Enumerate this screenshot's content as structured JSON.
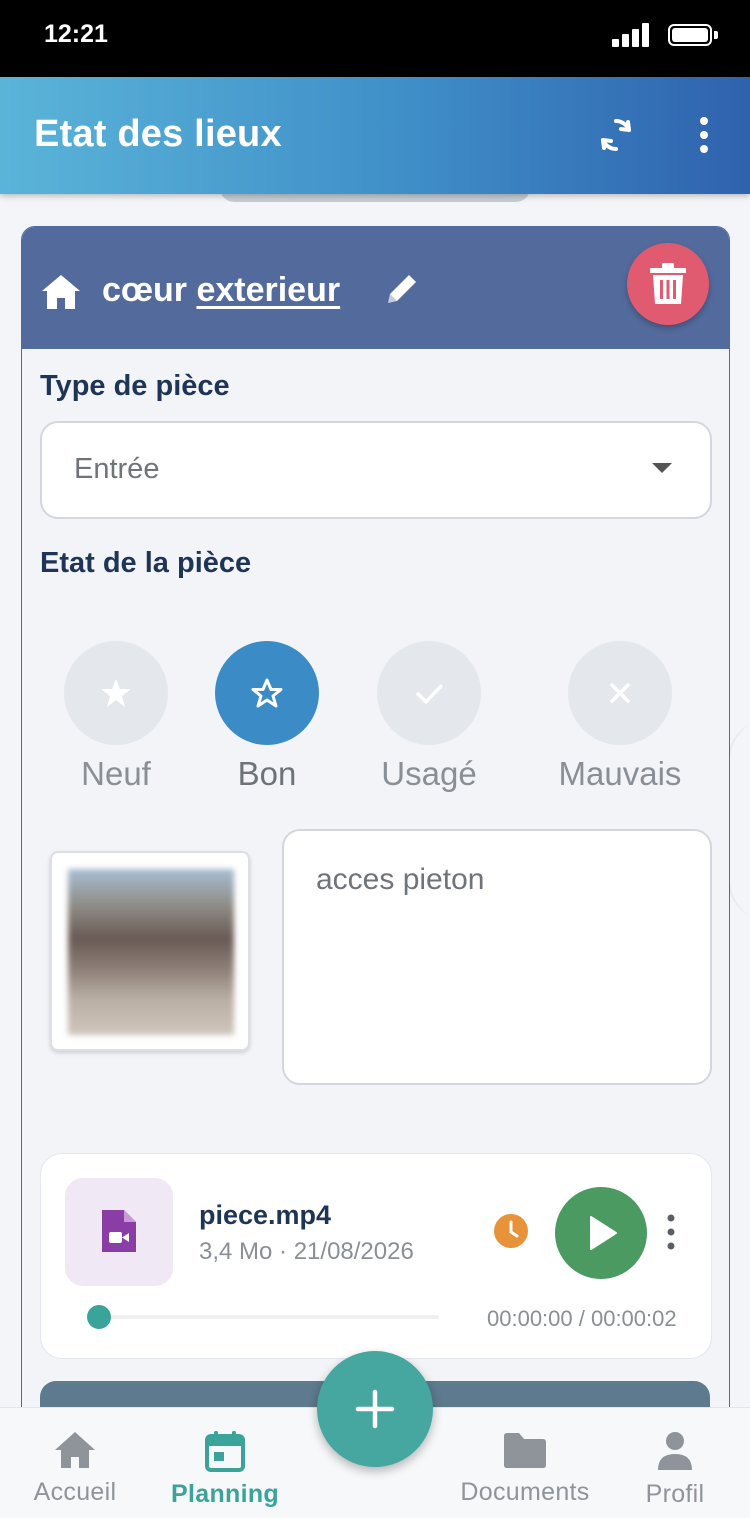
{
  "status_bar": {
    "time": "12:21"
  },
  "app_bar": {
    "title": "Etat des lieux"
  },
  "room": {
    "name_prefix": "cœur",
    "name_link": "exterieur",
    "type_label": "Type de pièce",
    "type_value": "Entrée",
    "state_label": "Etat de la pièce",
    "states": [
      {
        "label": "Neuf",
        "icon": "star-icon",
        "selected": false
      },
      {
        "label": "Bon",
        "icon": "star-outline-icon",
        "selected": true
      },
      {
        "label": "Usagé",
        "icon": "check-icon",
        "selected": false
      },
      {
        "label": "Mauvais",
        "icon": "x-icon",
        "selected": false
      }
    ],
    "comment": "acces pieton"
  },
  "media": {
    "file_name": "piece.mp4",
    "file_meta": "3,4 Mo · 21/08/2026",
    "time": "00:00:00 / 00:00:02",
    "progress": 0
  },
  "bottom_nav": {
    "items": [
      {
        "label": "Accueil",
        "icon": "home-icon"
      },
      {
        "label": "Planning",
        "icon": "calendar-icon",
        "active": true
      },
      {
        "label": "Documents",
        "icon": "folder-icon"
      },
      {
        "label": "Profil",
        "icon": "person-icon"
      }
    ]
  },
  "colors": {
    "accent": "#3aa39a",
    "header": "#536a9d",
    "selected_state": "#3b8cc6",
    "delete": "#e05a70",
    "play": "#4a9a62",
    "pending": "#e8923a"
  }
}
